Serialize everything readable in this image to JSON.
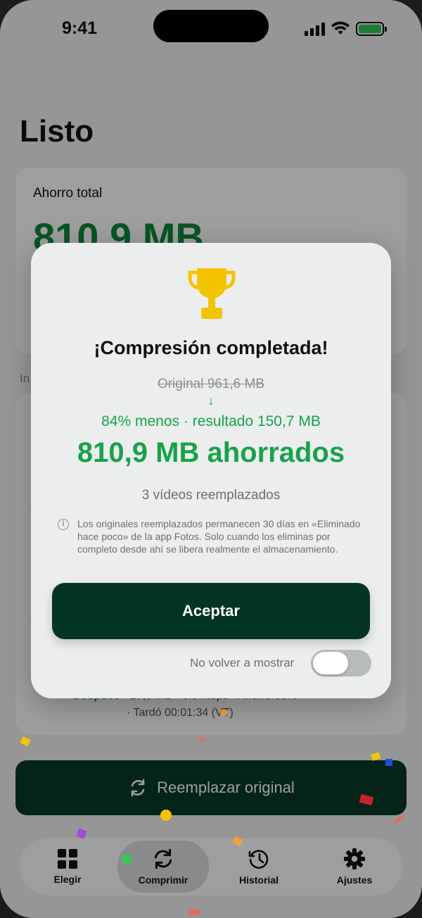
{
  "status_bar": {
    "time": "9:41"
  },
  "page": {
    "title": "Listo"
  },
  "total_card": {
    "label": "Ahorro total",
    "value": "810,9 MB"
  },
  "section": {
    "label_partial": "In"
  },
  "background_list": {
    "after_label": "Después",
    "after_text": "· 27,8 MB · 3.0 Mbps · Ahorro 80%",
    "time_text": "· Tardó 00:01:34 (VT)"
  },
  "replace_button": {
    "label": "Reemplazar original",
    "icon": "refresh-icon"
  },
  "tabbar": {
    "items": [
      {
        "label": "Elegir",
        "icon": "grid-icon",
        "active": false
      },
      {
        "label": "Comprimir",
        "icon": "refresh-icon",
        "active": true
      },
      {
        "label": "Historial",
        "icon": "history-icon",
        "active": false
      },
      {
        "label": "Ajustes",
        "icon": "gear-icon",
        "active": false
      }
    ]
  },
  "modal": {
    "icon": "trophy-icon",
    "title": "¡Compresión completada!",
    "original_line": "Original 961,6 MB",
    "arrow": "↓",
    "result_line": "84% menos · resultado 150,7 MB",
    "saved_line": "810,9 MB ahorrados",
    "replaced_line": "3 vídeos reemplazados",
    "info_text": "Los originales reemplazados permanecen 30 días en «Eliminado hace poco» de la app Fotos. Solo cuando los eliminas por completo desde ahí se libera realmente el almacenamiento.",
    "accept_label": "Aceptar",
    "no_show_label": "No volver a mostrar",
    "no_show_toggle_on": false
  },
  "colors": {
    "accent_green": "#18a24a",
    "dark_green": "#033522",
    "trophy_gold": "#f5c400"
  }
}
